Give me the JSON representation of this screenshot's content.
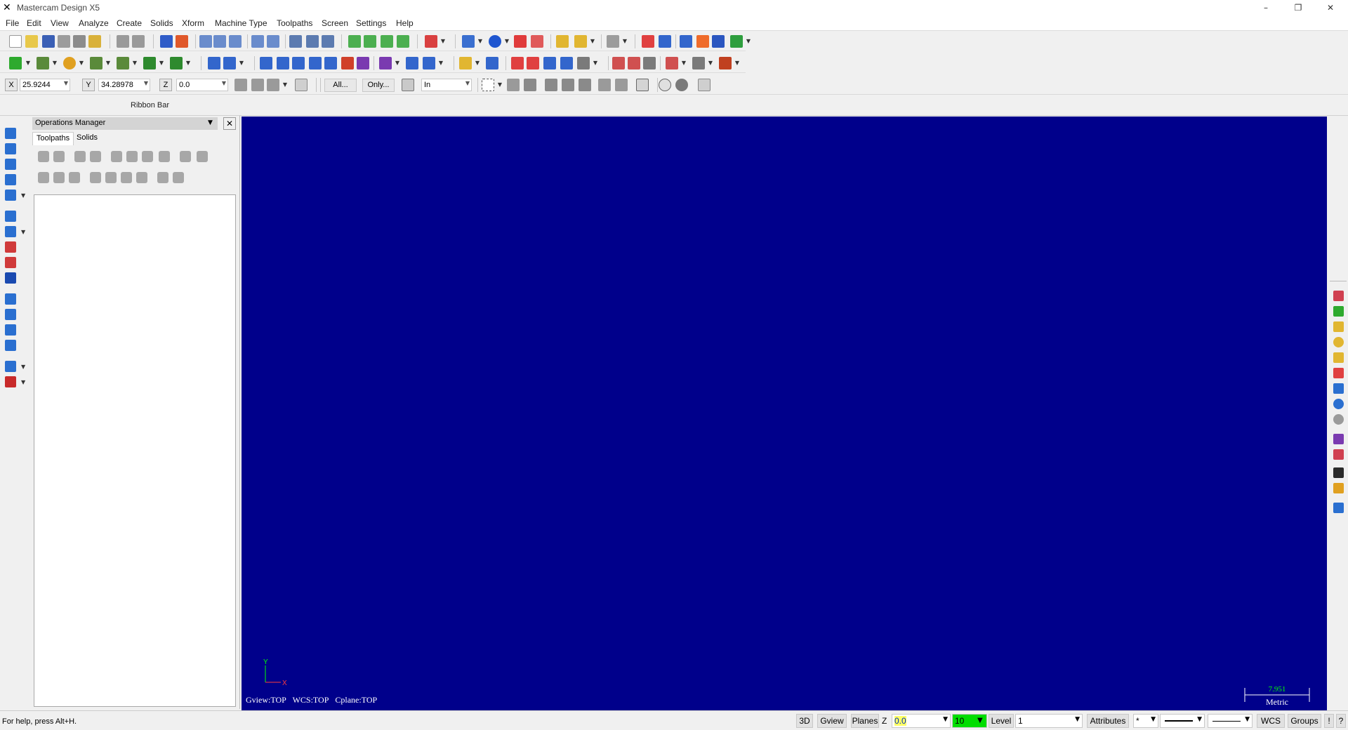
{
  "window": {
    "title": "Mastercam Design X5",
    "app_icon": "mastercam-icon",
    "minimize": "–",
    "restore": "❐",
    "close": "✕"
  },
  "menu": [
    "File",
    "Edit",
    "View",
    "Analyze",
    "Create",
    "Solids",
    "Xform",
    "Machine Type",
    "Toolpaths",
    "Screen",
    "Settings",
    "Help"
  ],
  "coordinates": {
    "x_label": "X",
    "x_value": "25.9244",
    "y_label": "Y",
    "y_value": "34.28978",
    "z_label": "Z",
    "z_value": "0.0"
  },
  "selection": {
    "all_label": "All...",
    "only_label": "Only...",
    "mode_value": "In"
  },
  "ribbon": {
    "label": "Ribbon Bar"
  },
  "operations_manager": {
    "title": "Operations Manager",
    "tabs": [
      "Toolpaths",
      "Solids"
    ],
    "active_tab": "Toolpaths",
    "close": "✕"
  },
  "viewport": {
    "background": "#00008b",
    "axis_y": "Y",
    "axis_x": "X",
    "gview": "Gview:TOP",
    "wcs": "WCS:TOP",
    "cplane": "Cplane:TOP",
    "scale_value": "7.951",
    "scale_unit": "Metric"
  },
  "status": {
    "help_text": "For help, press Alt+H.",
    "btn_3d": "3D",
    "btn_gview": "Gview",
    "btn_planes": "Planes",
    "z_label": "Z",
    "z_value": "0.0",
    "color_value": "10",
    "level_label": "Level",
    "level_value": "1",
    "attributes_label": "Attributes",
    "point_style": "*",
    "wcs_label": "WCS",
    "groups_label": "Groups",
    "extra_label": "!"
  },
  "colors": {
    "accent_green": "#00ff00",
    "z_highlight": "#ffff66",
    "color_swatch": "#00dd00"
  }
}
